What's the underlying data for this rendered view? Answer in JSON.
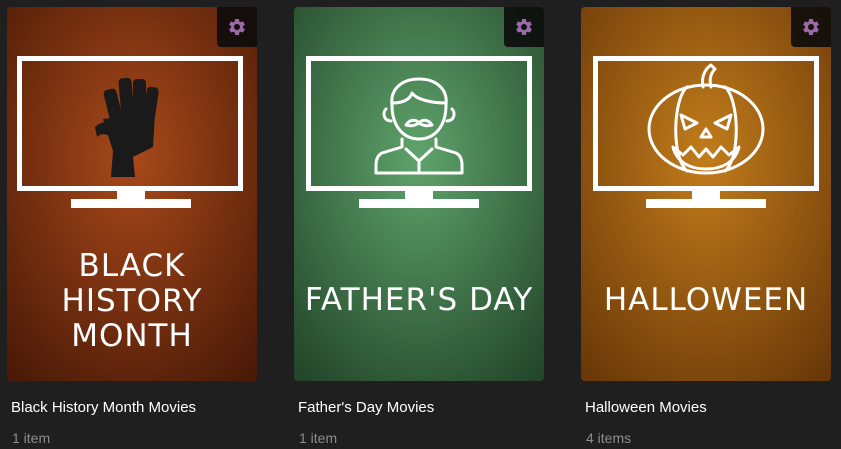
{
  "collections": [
    {
      "poster_lines": [
        "BLACK",
        "HISTORY",
        "MONTH"
      ],
      "title": "Black History Month Movies",
      "count": "1 item",
      "icon": "raised-fist-icon",
      "colors": {
        "center": "#a9491a",
        "edge": "#4a1a07"
      }
    },
    {
      "poster_lines": [
        "FATHER'S DAY"
      ],
      "title": "Father's Day Movies",
      "count": "1 item",
      "icon": "father-mustache-icon",
      "colors": {
        "center": "#5fa36b",
        "edge": "#23462a"
      }
    },
    {
      "poster_lines": [
        "HALLOWEEN"
      ],
      "title": "Halloween Movies",
      "count": "4 items",
      "icon": "jack-o-lantern-icon",
      "colors": {
        "center": "#c27c1b",
        "edge": "#6a3808"
      }
    }
  ],
  "settings_icon": "gear-icon",
  "accent": "#9a6aa8"
}
